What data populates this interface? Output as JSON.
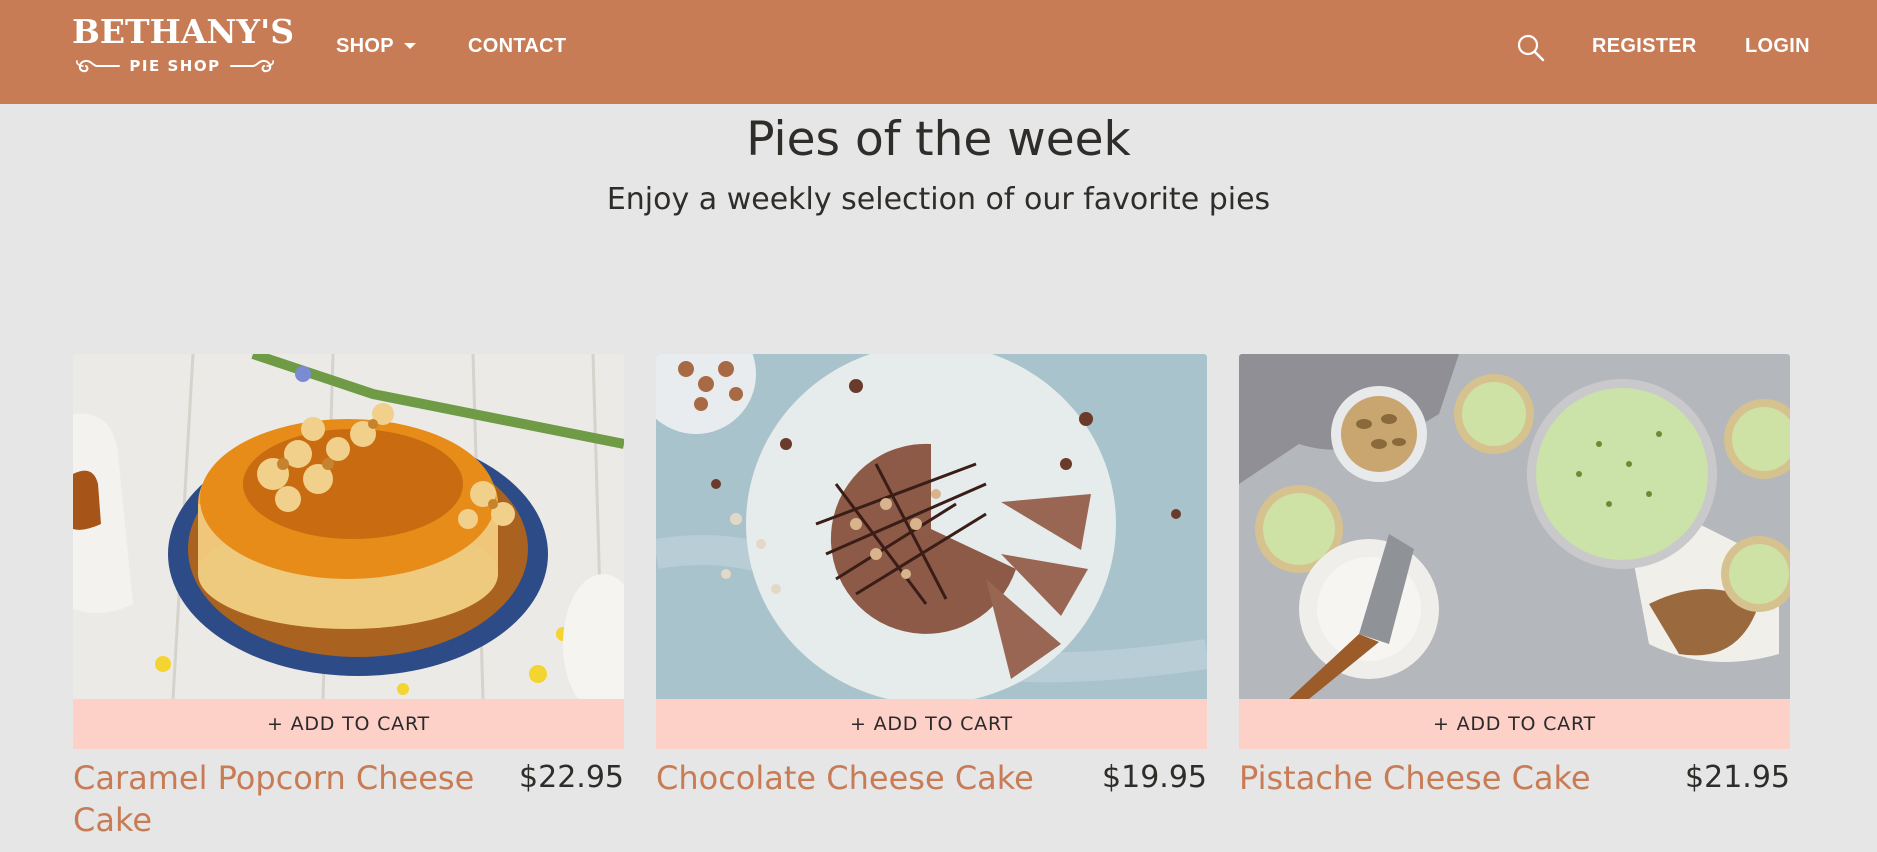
{
  "brand": {
    "name": "BETHANY'S",
    "tagline": "PIE SHOP"
  },
  "nav": {
    "shop_label": "SHOP",
    "contact_label": "CONTACT",
    "register_label": "REGISTER",
    "login_label": "LOGIN",
    "search_icon": "search-icon"
  },
  "hero": {
    "title": "Pies of the week",
    "subtitle": "Enjoy a weekly selection of our favorite pies"
  },
  "products": [
    {
      "name": "Caramel Popcorn Cheese Cake",
      "price": "$22.95",
      "cta": "+ ADD TO CART"
    },
    {
      "name": "Chocolate Cheese Cake",
      "price": "$19.95",
      "cta": "+ ADD TO CART"
    },
    {
      "name": "Pistache Cheese Cake",
      "price": "$21.95",
      "cta": "+ ADD TO CART"
    }
  ],
  "colors": {
    "brand": "#c87c55",
    "background": "#e6e6e6",
    "button": "#fdd0c8"
  }
}
